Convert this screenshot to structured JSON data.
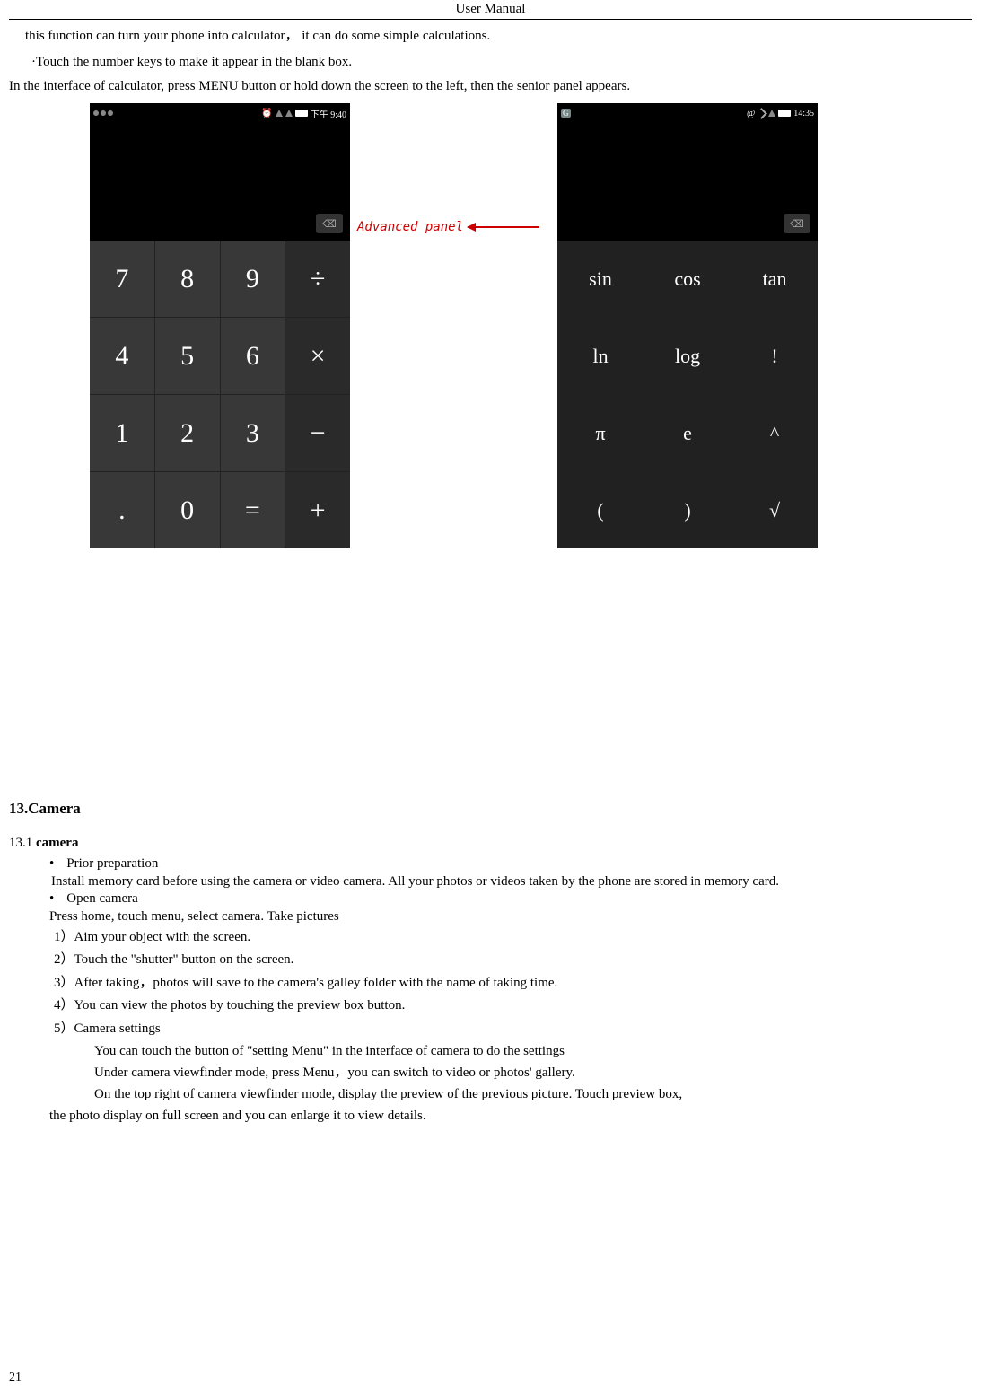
{
  "header": {
    "title": "User    Manual"
  },
  "intro": {
    "p1": "this function can turn your phone into calculator，   it can do some simple calculations.",
    "p2": "·Touch the number keys to make it appear in the blank box.",
    "p3": "In the interface of calculator, press MENU button or hold down the screen to the left, then the senior panel appears."
  },
  "screenshot1": {
    "time": "下午 9:40",
    "status_icons": [
      "alarm",
      "signal",
      "signal",
      "battery"
    ],
    "keys": [
      "7",
      "8",
      "9",
      "÷",
      "4",
      "5",
      "6",
      "×",
      "1",
      "2",
      "3",
      "−",
      ".",
      "0",
      "=",
      "+"
    ]
  },
  "annotation": {
    "label": "Advanced panel"
  },
  "screenshot2": {
    "time": "14:35",
    "status_left": "G",
    "keys": [
      "sin",
      "cos",
      "tan",
      "ln",
      "log",
      "!",
      "π",
      "e",
      "^",
      "(",
      ")",
      "√"
    ]
  },
  "section13": {
    "heading": "13.Camera",
    "sub": {
      "num": "13.1 ",
      "bold": "camera"
    },
    "bullet1": "Prior preparation",
    "bullet1_text": "Install memory card before using the camera or video camera. All your photos or videos taken by the phone are stored in memory card.",
    "bullet2": "Open camera",
    "bullet2_text": "Press home, touch menu, select camera. Take pictures",
    "steps": {
      "s1": "1）Aim your object with the screen.",
      "s2": "2）Touch the \"shutter\" button on the screen.",
      "s3": "3）After taking，photos will save to the camera's galley folder with the name of taking time.",
      "s4": "4）You can view the photos by touching the preview box button.",
      "s5": "5）Camera settings"
    },
    "deep": {
      "d1": "You can touch the button of \"setting Menu\" in the interface of camera to do the settings",
      "d2": "Under camera viewfinder mode, press Menu，you can switch to video or photos' gallery.",
      "d3a": "On the top right of camera viewfinder mode, display the preview of the previous picture. Touch preview box,",
      "d3b": "the photo display on full screen and you can enlarge it to view details."
    }
  },
  "page_number": "21"
}
